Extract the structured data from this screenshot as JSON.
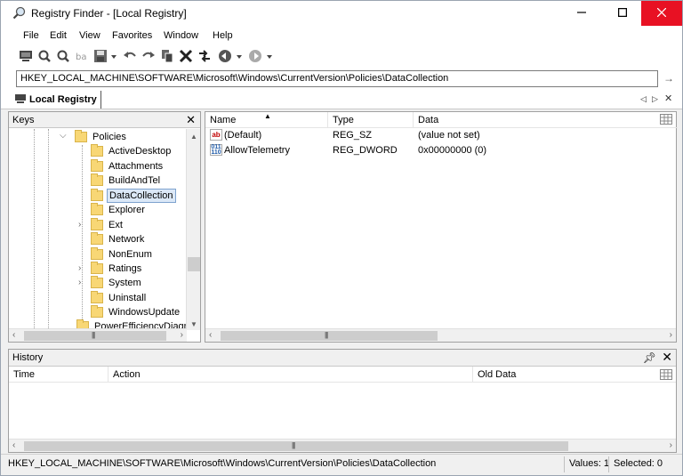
{
  "window": {
    "title": "Registry Finder - [Local Registry]"
  },
  "menu": {
    "items": [
      "File",
      "Edit",
      "View",
      "Favorites",
      "Window",
      "Help"
    ]
  },
  "address": {
    "path": "HKEY_LOCAL_MACHINE\\SOFTWARE\\Microsoft\\Windows\\CurrentVersion\\Policies\\DataCollection"
  },
  "tab": {
    "label": "Local Registry"
  },
  "keys_pane": {
    "title": "Keys",
    "tree": [
      {
        "label": "Policies",
        "expanded": true,
        "selected": false
      },
      {
        "label": "ActiveDesktop",
        "selected": false
      },
      {
        "label": "Attachments",
        "selected": false
      },
      {
        "label": "BuildAndTel",
        "selected": false
      },
      {
        "label": "DataCollection",
        "selected": true
      },
      {
        "label": "Explorer",
        "selected": false
      },
      {
        "label": "Ext",
        "has_children": true
      },
      {
        "label": "Network",
        "selected": false
      },
      {
        "label": "NonEnum",
        "selected": false
      },
      {
        "label": "Ratings",
        "has_children": true
      },
      {
        "label": "System",
        "has_children": true
      },
      {
        "label": "Uninstall",
        "selected": false
      },
      {
        "label": "WindowsUpdate",
        "selected": false
      },
      {
        "label": "PowerEfficiencyDiagnostics",
        "selected": false
      }
    ]
  },
  "values_pane": {
    "columns": [
      "Name",
      "Type",
      "Data"
    ],
    "rows": [
      {
        "name": "(Default)",
        "type": "REG_SZ",
        "data": "(value not set)",
        "icon": "string-value-icon"
      },
      {
        "name": "AllowTelemetry",
        "type": "REG_DWORD",
        "data": "0x00000000 (0)",
        "icon": "dword-value-icon"
      }
    ]
  },
  "history_pane": {
    "title": "History",
    "columns": [
      "Time",
      "Action",
      "Old Data"
    ]
  },
  "statusbar": {
    "path": "HKEY_LOCAL_MACHINE\\SOFTWARE\\Microsoft\\Windows\\CurrentVersion\\Policies\\DataCollection",
    "values": "Values: 1",
    "selected": "Selected: 0"
  },
  "colors": {
    "close_button": "#e81123",
    "selection_bg": "#dbe8f7",
    "selection_border": "#7da2ce",
    "folder": "#f8d775"
  }
}
